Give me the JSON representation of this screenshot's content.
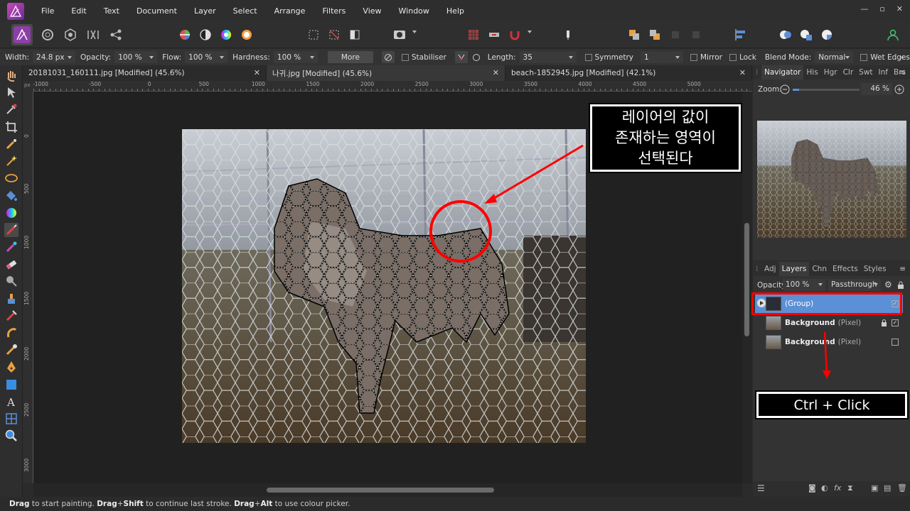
{
  "menubar": {
    "items": [
      "File",
      "Edit",
      "Text",
      "Document",
      "Layer",
      "Select",
      "Arrange",
      "Filters",
      "View",
      "Window",
      "Help"
    ],
    "window_controls": [
      "—",
      "▫",
      "✕"
    ]
  },
  "context_toolbar": {
    "width_label": "Width:",
    "width_value": "24.8 px",
    "opacity_label": "Opacity:",
    "opacity_value": "100 %",
    "flow_label": "Flow:",
    "flow_value": "100 %",
    "hardness_label": "Hardness:",
    "hardness_value": "100 %",
    "more_label": "More",
    "stabiliser_label": "Stabiliser",
    "length_label": "Length:",
    "length_value": "35",
    "symmetry_label": "Symmetry",
    "symmetry_value": "1",
    "mirror_label": "Mirror",
    "lock_label": "Lock",
    "blend_label": "Blend Mode:",
    "blend_value": "Normal",
    "wet_edges_label": "Wet Edges"
  },
  "tabs": [
    {
      "label": "20181031_160111.jpg [Modified] (45.6%)",
      "active": false
    },
    {
      "label": "나귀.jpg [Modified] (45.6%)",
      "active": true
    },
    {
      "label": "beach-1852945.jpg [Modified] (42.1%)",
      "active": false
    }
  ],
  "ruler": {
    "h_unit": "px",
    "h_ticks": [
      "-1000",
      "-500",
      "0",
      "500",
      "1000",
      "1500",
      "2000",
      "2500",
      "3000",
      "3500",
      "4000",
      "4500",
      "5000"
    ],
    "v_ticks": [
      "0",
      "500",
      "1000",
      "1500",
      "2000",
      "2500",
      "3000"
    ]
  },
  "navigator": {
    "tabs": [
      "Navigator",
      "His",
      "Hgr",
      "Clr",
      "Swt",
      "Inf",
      "Brs"
    ],
    "zoom_label": "Zoom:",
    "zoom_value": "46 %",
    "zoom_fraction": 0.1
  },
  "layers_panel": {
    "tabs": [
      "Adj",
      "Layers",
      "Chn",
      "Effects",
      "Styles"
    ],
    "opacity_label": "Opacity:",
    "opacity_value": "100 %",
    "blend_value": "Passthrough",
    "layers": [
      {
        "name": "(Group)",
        "type": "",
        "selected": true,
        "checked": true,
        "locked": false
      },
      {
        "name": "Background",
        "type": "(Pixel)",
        "selected": false,
        "checked": true,
        "locked": true
      },
      {
        "name": "Background",
        "type": "(Pixel)",
        "selected": false,
        "checked": false,
        "locked": false
      }
    ]
  },
  "annotations": {
    "callout_main_lines": [
      "레이어의 값이",
      "존재하는 영역이",
      "선택된다"
    ],
    "callout_action": "Ctrl + Click",
    "highlight_color": "#ff0000"
  },
  "statusbar": {
    "parts": [
      {
        "text": "Drag",
        "bold": true
      },
      {
        "text": " to start painting. ",
        "bold": false
      },
      {
        "text": "Drag",
        "bold": true
      },
      {
        "text": "+",
        "bold": false
      },
      {
        "text": "Shift",
        "bold": true
      },
      {
        "text": " to continue last stroke. ",
        "bold": false
      },
      {
        "text": "Drag",
        "bold": true
      },
      {
        "text": "+",
        "bold": false
      },
      {
        "text": "Alt",
        "bold": true
      },
      {
        "text": " to use colour picker.",
        "bold": false
      }
    ]
  },
  "colors": {
    "accent": "#5b8fd6",
    "selected_layer": "#5b8fd6"
  }
}
